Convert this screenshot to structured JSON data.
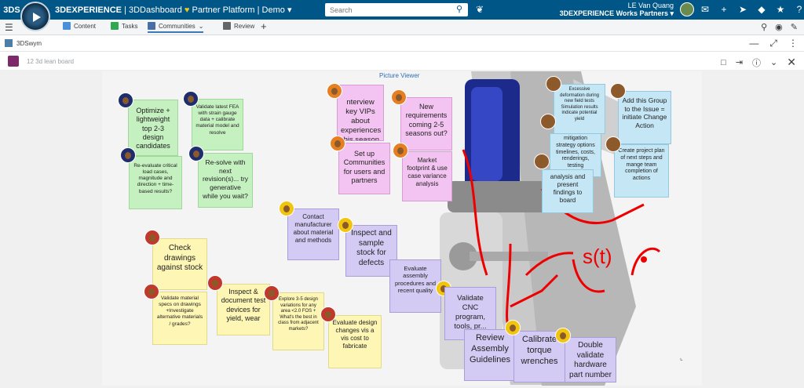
{
  "topbar": {
    "logo_text": "3DS",
    "app_prefix": "3DEXPERIENCE",
    "app_name": " | 3DDashboard",
    "platform": "Partner Platform | Demo",
    "search_placeholder": "Search",
    "user_name": "LE Van Quang",
    "company": "3DEXPERIENCE Works Partners",
    "icons": [
      "search-icon",
      "tag-icon",
      "avatar",
      "chat-icon",
      "plus-icon",
      "share-icon",
      "network-icon",
      "apps-icon",
      "help-icon"
    ]
  },
  "tabs": {
    "items": [
      {
        "label": "Content",
        "icon": "content-icon",
        "color": "#4a90d9"
      },
      {
        "label": "Tasks",
        "icon": "tasks-icon",
        "color": "#2fa84f"
      },
      {
        "label": "Communities",
        "icon": "communities-icon",
        "color": "#4a6fa5"
      },
      {
        "label": "Review",
        "icon": "review-icon",
        "color": "#666666"
      }
    ],
    "add_label": "+"
  },
  "widget": {
    "title": "3DSwym"
  },
  "board": {
    "title": "12 3d lean board"
  },
  "canvas": {
    "picture_viewer": "Picture Viewer",
    "markup_text": "s(t)"
  },
  "notes": {
    "n1": "Optimize + lightweight top 2-3 design candidates",
    "n2": "Validate latest FEA with strain gauge data + calibrate material model and resolve",
    "n3": "Re-evaluate critical load cases, magnitude and direction + time-based results?",
    "n4": "Re-solve with next revision(s)... try generative while you wait?",
    "n5": "Check drawings against stock",
    "n6": "Validate material specs on drawings +Investigate alternative materials / grades?",
    "n7": "Inspect & document test devices for yield, wear",
    "n8": "Explore 3-5 design variations for any area <2.0 FOS + What's the best in class from adjacent markets?",
    "n9": "Evaluate design changes vis a vis cost to fabricate",
    "n10": "nterview key VIPs about experiences this season",
    "n11": "Set up Communities for users and partners",
    "n12": "New requirements coming 2-5 seasons out?",
    "n13": "Market footprint & use case variance analysis",
    "n14": "Contact manufacturer about material and methods",
    "n15": "Inspect and sample stock for defects",
    "n16": "Evaluate assembly procedures and recent quality",
    "n17": "Validate CNC program, tools, pr...",
    "n18": "Review Assembly Guidelines",
    "n19": "Calibrate torque wrenches",
    "n20": "Double validate hardware part number",
    "n21": "Excessive deformation during new field tests  Simulation results indicate potential yield",
    "n22": "Add this Group to the Issue = initiate Change Action",
    "n23": "mitigation strategy options timelines, costs, renderings, testing",
    "n24": "Create project plan of next steps and mange team completion of actions",
    "n25": "analysis and present findings to board"
  }
}
